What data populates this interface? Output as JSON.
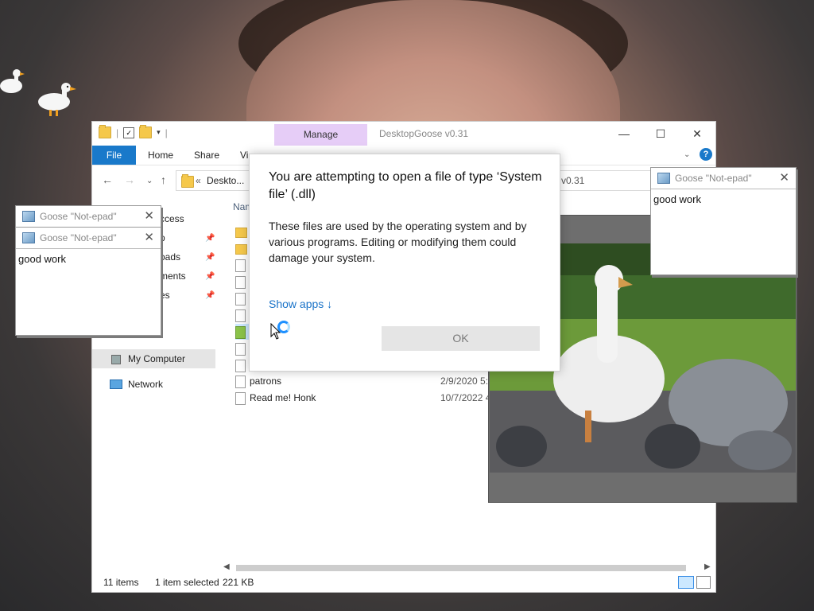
{
  "explorer": {
    "manage_tab": "Manage",
    "window_title": "DesktopGoose v0.31",
    "ribbon": {
      "file": "File",
      "home": "Home",
      "share": "Share",
      "view": "Vi"
    },
    "address": "Deskto...",
    "address_right": "v0.31",
    "nav": {
      "quick_access": "ccess",
      "item_p": "p",
      "item_downloads": "oads",
      "item_documents": "ments",
      "item_pictures": "es",
      "my_computer": "My Computer",
      "network": "Network"
    },
    "column_header": "Nam",
    "files": [
      {
        "name": "patrons",
        "date": "2/9/2020 5:0"
      },
      {
        "name": "Read me! Honk",
        "date": "10/7/2022 4"
      }
    ],
    "status": {
      "items": "11 items",
      "selected": "1 item selected",
      "size": "221 KB"
    }
  },
  "dialog": {
    "title": "You are attempting to open a file of type ‘System file’ (.dll)",
    "body": "These files are used by the operating system and by various programs. Editing or modifying them could damage your system.",
    "show_apps": "Show apps ↓",
    "ok": "OK"
  },
  "notepads": {
    "left_back_title": "Goose \"Not-epad\"",
    "left_front_title": "Goose \"Not-epad\"",
    "left_text": "good work",
    "right_title": "Goose \"Not-epad\"",
    "right_text": "good work"
  },
  "colors": {
    "accent": "#1979ca",
    "manage": "#e6cdf7",
    "dialog_link": "#1a73c8"
  }
}
